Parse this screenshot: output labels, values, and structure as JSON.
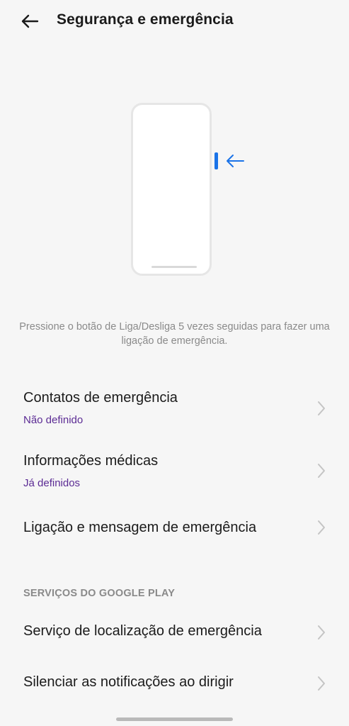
{
  "header": {
    "title": "Segurança e emergência",
    "back_icon": "arrow-left-icon"
  },
  "illustration": {
    "icon": "phone-power-button-icon",
    "accent_color": "#1a73e8"
  },
  "description": "Pressione o botão de Liga/Desliga 5 vezes seguidas para fazer uma ligação de emergência.",
  "items": [
    {
      "title": "Contatos de emergência",
      "subtitle": "Não definido"
    },
    {
      "title": "Informações médicas",
      "subtitle": "Já definidos"
    },
    {
      "title": "Ligação e mensagem de emergência"
    }
  ],
  "google_section": {
    "header": "SERVIÇOS DO GOOGLE PLAY",
    "items": [
      {
        "title": "Serviço de localização de emergência"
      },
      {
        "title": "Silenciar as notificações ao dirigir"
      }
    ]
  },
  "colors": {
    "background": "#f6f6f6",
    "subtitle": "#5b2b94",
    "secondary_text": "#8a8a8a"
  }
}
